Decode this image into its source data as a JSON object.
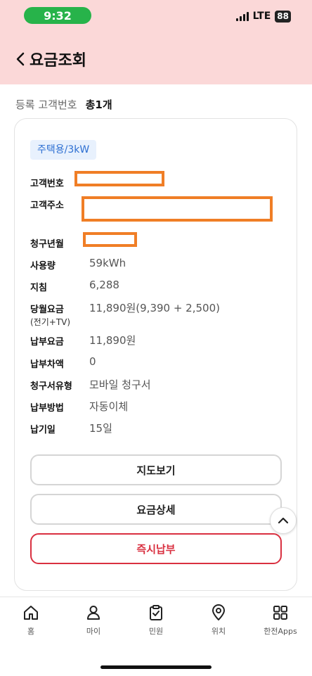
{
  "status": {
    "time": "9:32",
    "network": "LTE",
    "battery": "88"
  },
  "header": {
    "title": "요금조회"
  },
  "summary": {
    "label": "등록 고객번호",
    "count": "총1개"
  },
  "card": {
    "badge": "주택용/3kW",
    "rows": [
      {
        "label": "고객번호",
        "value": ""
      },
      {
        "label": "고객주소",
        "value": ""
      },
      {
        "label": "청구년월",
        "value": ""
      },
      {
        "label": "사용량",
        "value": "59kWh"
      },
      {
        "label": "지침",
        "value": "6,288"
      },
      {
        "label": "당월요금",
        "sub": "(전기+TV)",
        "value": "11,890원(9,390 + 2,500)"
      },
      {
        "label": "납부요금",
        "value": "11,890원"
      },
      {
        "label": "납부차액",
        "value": "0"
      },
      {
        "label": "청구서유형",
        "value": "모바일 청구서"
      },
      {
        "label": "납부방법",
        "value": "자동이체"
      },
      {
        "label": "납기일",
        "value": "15일"
      }
    ],
    "buttons": {
      "map": "지도보기",
      "detail": "요금상세",
      "pay": "즉시납부"
    }
  },
  "nav": [
    {
      "label": "홈",
      "icon": "home-icon"
    },
    {
      "label": "마이",
      "icon": "user-icon"
    },
    {
      "label": "민원",
      "icon": "clipboard-check-icon"
    },
    {
      "label": "위치",
      "icon": "location-pin-icon"
    },
    {
      "label": "한전Apps",
      "icon": "apps-grid-icon"
    }
  ],
  "colors": {
    "header_bg": "#fbd8d8",
    "accent_red": "#d93040",
    "badge_blue": "#2d6fd2",
    "redaction": "#f07e26"
  }
}
